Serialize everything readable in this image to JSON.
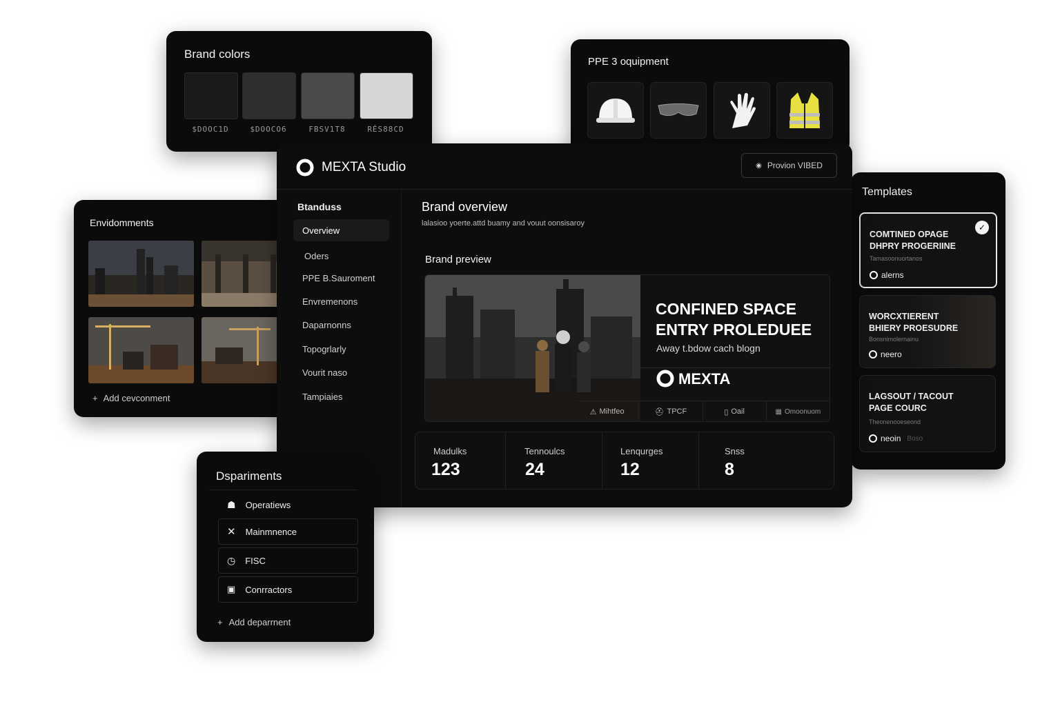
{
  "brand_colors": {
    "title": "Brand colors",
    "swatches": [
      {
        "label": "$DOOC1D",
        "color": "#1a1a1a"
      },
      {
        "label": "$DOOCO6",
        "color": "#2e2e2e"
      },
      {
        "label": "FBSV1T8",
        "color": "#4a4a4a"
      },
      {
        "label": "RÉS88CD",
        "color": "#d6d6d4"
      }
    ]
  },
  "ppe": {
    "title": "PPE 3 oquipment",
    "items": [
      "hard-hat-icon",
      "safety-glasses-icon",
      "glove-icon",
      "safety-vest-icon"
    ]
  },
  "environments": {
    "title": "Envidomments",
    "add_label": "Add cevconment"
  },
  "main": {
    "app_title": "MEXTA Studio",
    "preview_button": "Provion VIBED",
    "sidebar": {
      "heading": "Btanduss",
      "items": [
        "Overview",
        "Oders",
        "PPE B.Sauroment",
        "Envremenons",
        "Daparnonns",
        "Topogrlarly",
        "Vourit naso",
        "Tampiaies"
      ]
    },
    "overview": {
      "title": "Brand overview",
      "subtitle": "lalasioo yoerte.attd buamy and vouut oonsisaroy"
    },
    "preview": {
      "heading": "Brand preview",
      "headline_1": "CONFINED SPACE",
      "headline_2": "ENTRY PROLEDUEE",
      "tagline": "Away t.bdow cach blogn",
      "brand": "MEXTA",
      "chips": [
        "Mihtfeo",
        "TPCF",
        "Oail",
        "Omoonuom"
      ]
    },
    "stats": [
      {
        "label": "Madulks",
        "value": "123"
      },
      {
        "label": "Tennoulcs",
        "value": "24"
      },
      {
        "label": "Lenqurges",
        "value": "12"
      },
      {
        "label": "Snss",
        "value": "8"
      }
    ]
  },
  "templates": {
    "title": "Templates",
    "cards": [
      {
        "title_1": "COMTINED OPAGE",
        "title_2": "DHPRY PROGERIINE",
        "sub": "Tamasoonuortanos",
        "label": "alerns"
      },
      {
        "title_1": "WORCXTIERENT",
        "title_2": "BHIERY PROESUDRE",
        "sub": "Bonsnimolernainu",
        "label": "neero"
      },
      {
        "title_1": "LAGSOUT / TACOUT",
        "title_2": "PAGE COURC",
        "sub": "Theonenooeseond",
        "label": "neoin",
        "label_extra": "Boso"
      }
    ]
  },
  "departments": {
    "title": "Dspariments",
    "items": [
      {
        "label": "Operatiews",
        "icon": "workers-icon"
      },
      {
        "label": "Mainmnence",
        "icon": "wrench-icon"
      },
      {
        "label": "FISC",
        "icon": "clock-icon"
      },
      {
        "label": "Conrractors",
        "icon": "id-card-icon"
      }
    ],
    "add_label": "Add deparrnent"
  }
}
